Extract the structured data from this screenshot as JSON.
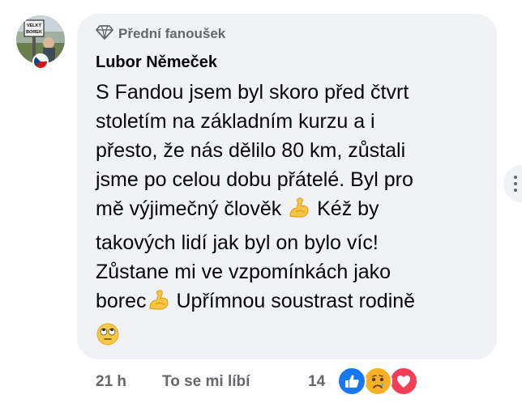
{
  "comment": {
    "badge_label": "Přední fanoušek",
    "author": "Lubor Němeček",
    "body_lines": [
      "S Fandou jsem byl skoro před čtvrt",
      "stoletím na základním kurzu a i",
      "přesto, že nás dělilo 80 km, zůstali",
      "jsme po celou dobu přátelé. Byl pro",
      "mě výjimečný člověk",
      " Kéž by",
      "takových lidí jak byl on bylo víc!",
      "Zůstane mi ve vzpomínkách jako",
      "borec",
      " Upřímnou soustrast rodině"
    ],
    "emojis": [
      "flexed-biceps-emoji",
      "flexed-biceps-emoji",
      "rolling-eyes-emoji"
    ]
  },
  "avatar": {
    "sign_text": [
      "VELKÝ",
      "BOREK"
    ],
    "flag": "czech-flag-icon"
  },
  "footer": {
    "time": "21 h",
    "like_label": "To se mi líbí",
    "reaction_count": "14",
    "reactions": [
      "like-reaction-icon",
      "sad-reaction-icon",
      "love-reaction-icon"
    ]
  },
  "colors": {
    "bubble": "#f0f2f5",
    "secondary_text": "#65676b",
    "like_blue": "#1877f2",
    "love_red": "#f33e58",
    "sad_yellow": "#f7b125"
  }
}
